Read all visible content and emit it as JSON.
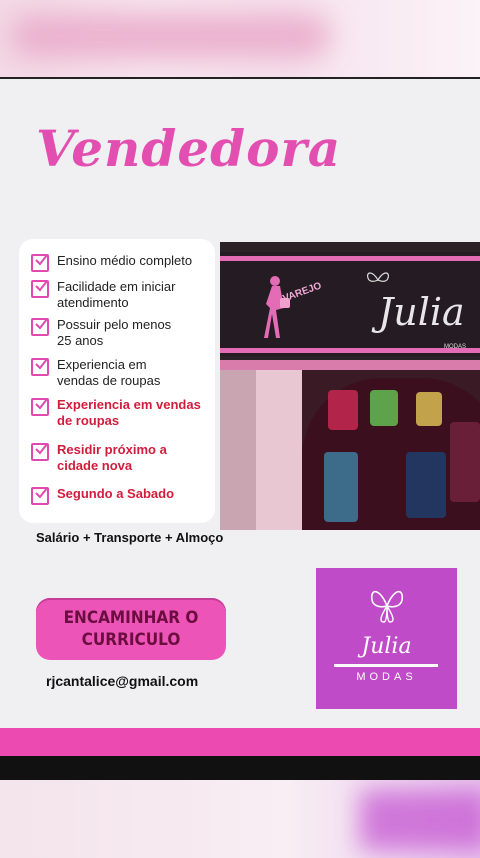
{
  "title": "Vendedora",
  "requirements": [
    {
      "text": "Ensino médio completo",
      "highlight": false
    },
    {
      "text": "Facilidade em iniciar atendimento",
      "highlight": false
    },
    {
      "text": "Possuir pelo menos 25 anos",
      "highlight": false
    },
    {
      "text": "Experiencia em vendas de roupas",
      "highlight": false
    },
    {
      "text": "Experiencia em vendas de roupas",
      "highlight": true
    },
    {
      "text": "Residir próximo a cidade nova",
      "highlight": true
    },
    {
      "text": "Segundo a Sabado",
      "highlight": true
    }
  ],
  "benefits": "Salário + Transporte + Almoço",
  "cta_label": "ENCAMINHAR O CURRICULO",
  "email": "rjcantalice@gmail.com",
  "photo": {
    "sign_name": "Julia",
    "sign_tag": "VAREJO",
    "sign_sub": "MODAS"
  },
  "logo": {
    "script": "Julia",
    "subtitle": "MODAS"
  },
  "colors": {
    "accent": "#e34fb1",
    "highlight_text": "#d21c3b",
    "logo_bg": "#bf4bc9",
    "bar": "#ec4ab0"
  },
  "icons": {
    "check": "checkbox-check-icon",
    "butterfly": "butterfly-icon"
  }
}
